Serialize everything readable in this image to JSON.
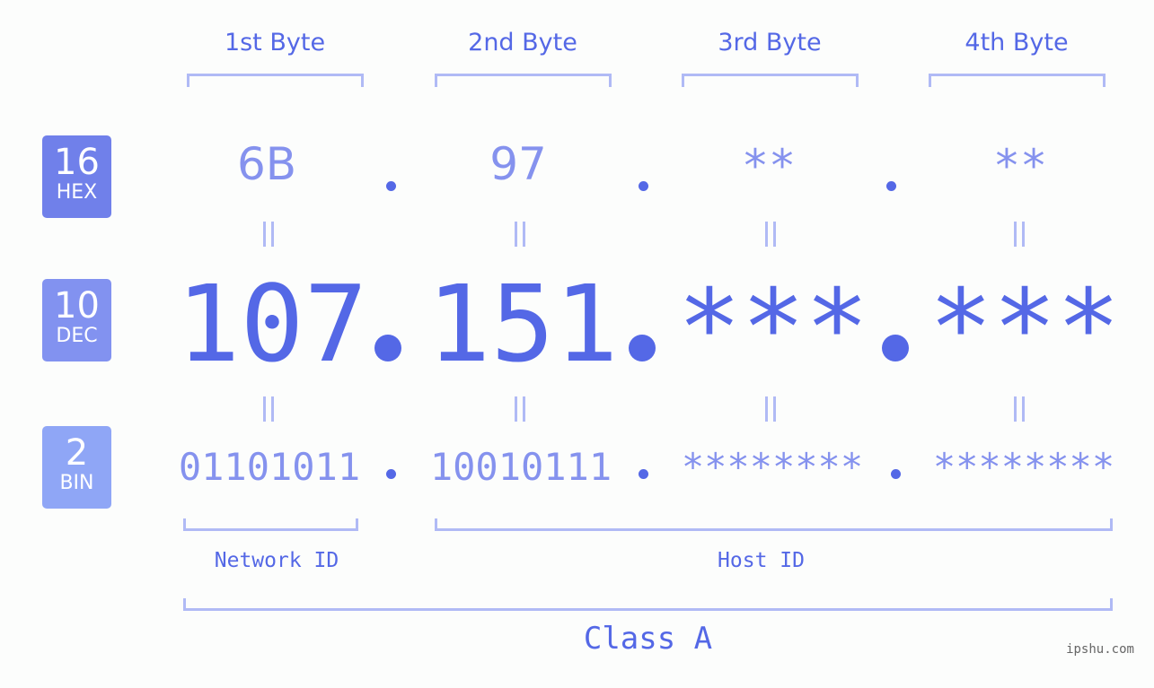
{
  "bytes": [
    {
      "header": "1st Byte",
      "hex": "6B",
      "dec": "107",
      "bin": "01101011"
    },
    {
      "header": "2nd Byte",
      "hex": "97",
      "dec": "151",
      "bin": "10010111"
    },
    {
      "header": "3rd Byte",
      "hex": "**",
      "dec": "***",
      "bin": "********"
    },
    {
      "header": "4th Byte",
      "hex": "**",
      "dec": "***",
      "bin": "********"
    }
  ],
  "badges": {
    "hex": {
      "number": "16",
      "label": "HEX",
      "color": "#7080ea"
    },
    "dec": {
      "number": "10",
      "label": "DEC",
      "color": "#8292f0"
    },
    "bin": {
      "number": "2",
      "label": "BIN",
      "color": "#8fa6f6"
    }
  },
  "labels": {
    "network_id": "Network ID",
    "host_id": "Host ID",
    "class": "Class A"
  },
  "colors": {
    "accent": "#5468e6",
    "light": "#8592ee",
    "bracket": "#b0baf5"
  },
  "watermark": "ipshu.com"
}
